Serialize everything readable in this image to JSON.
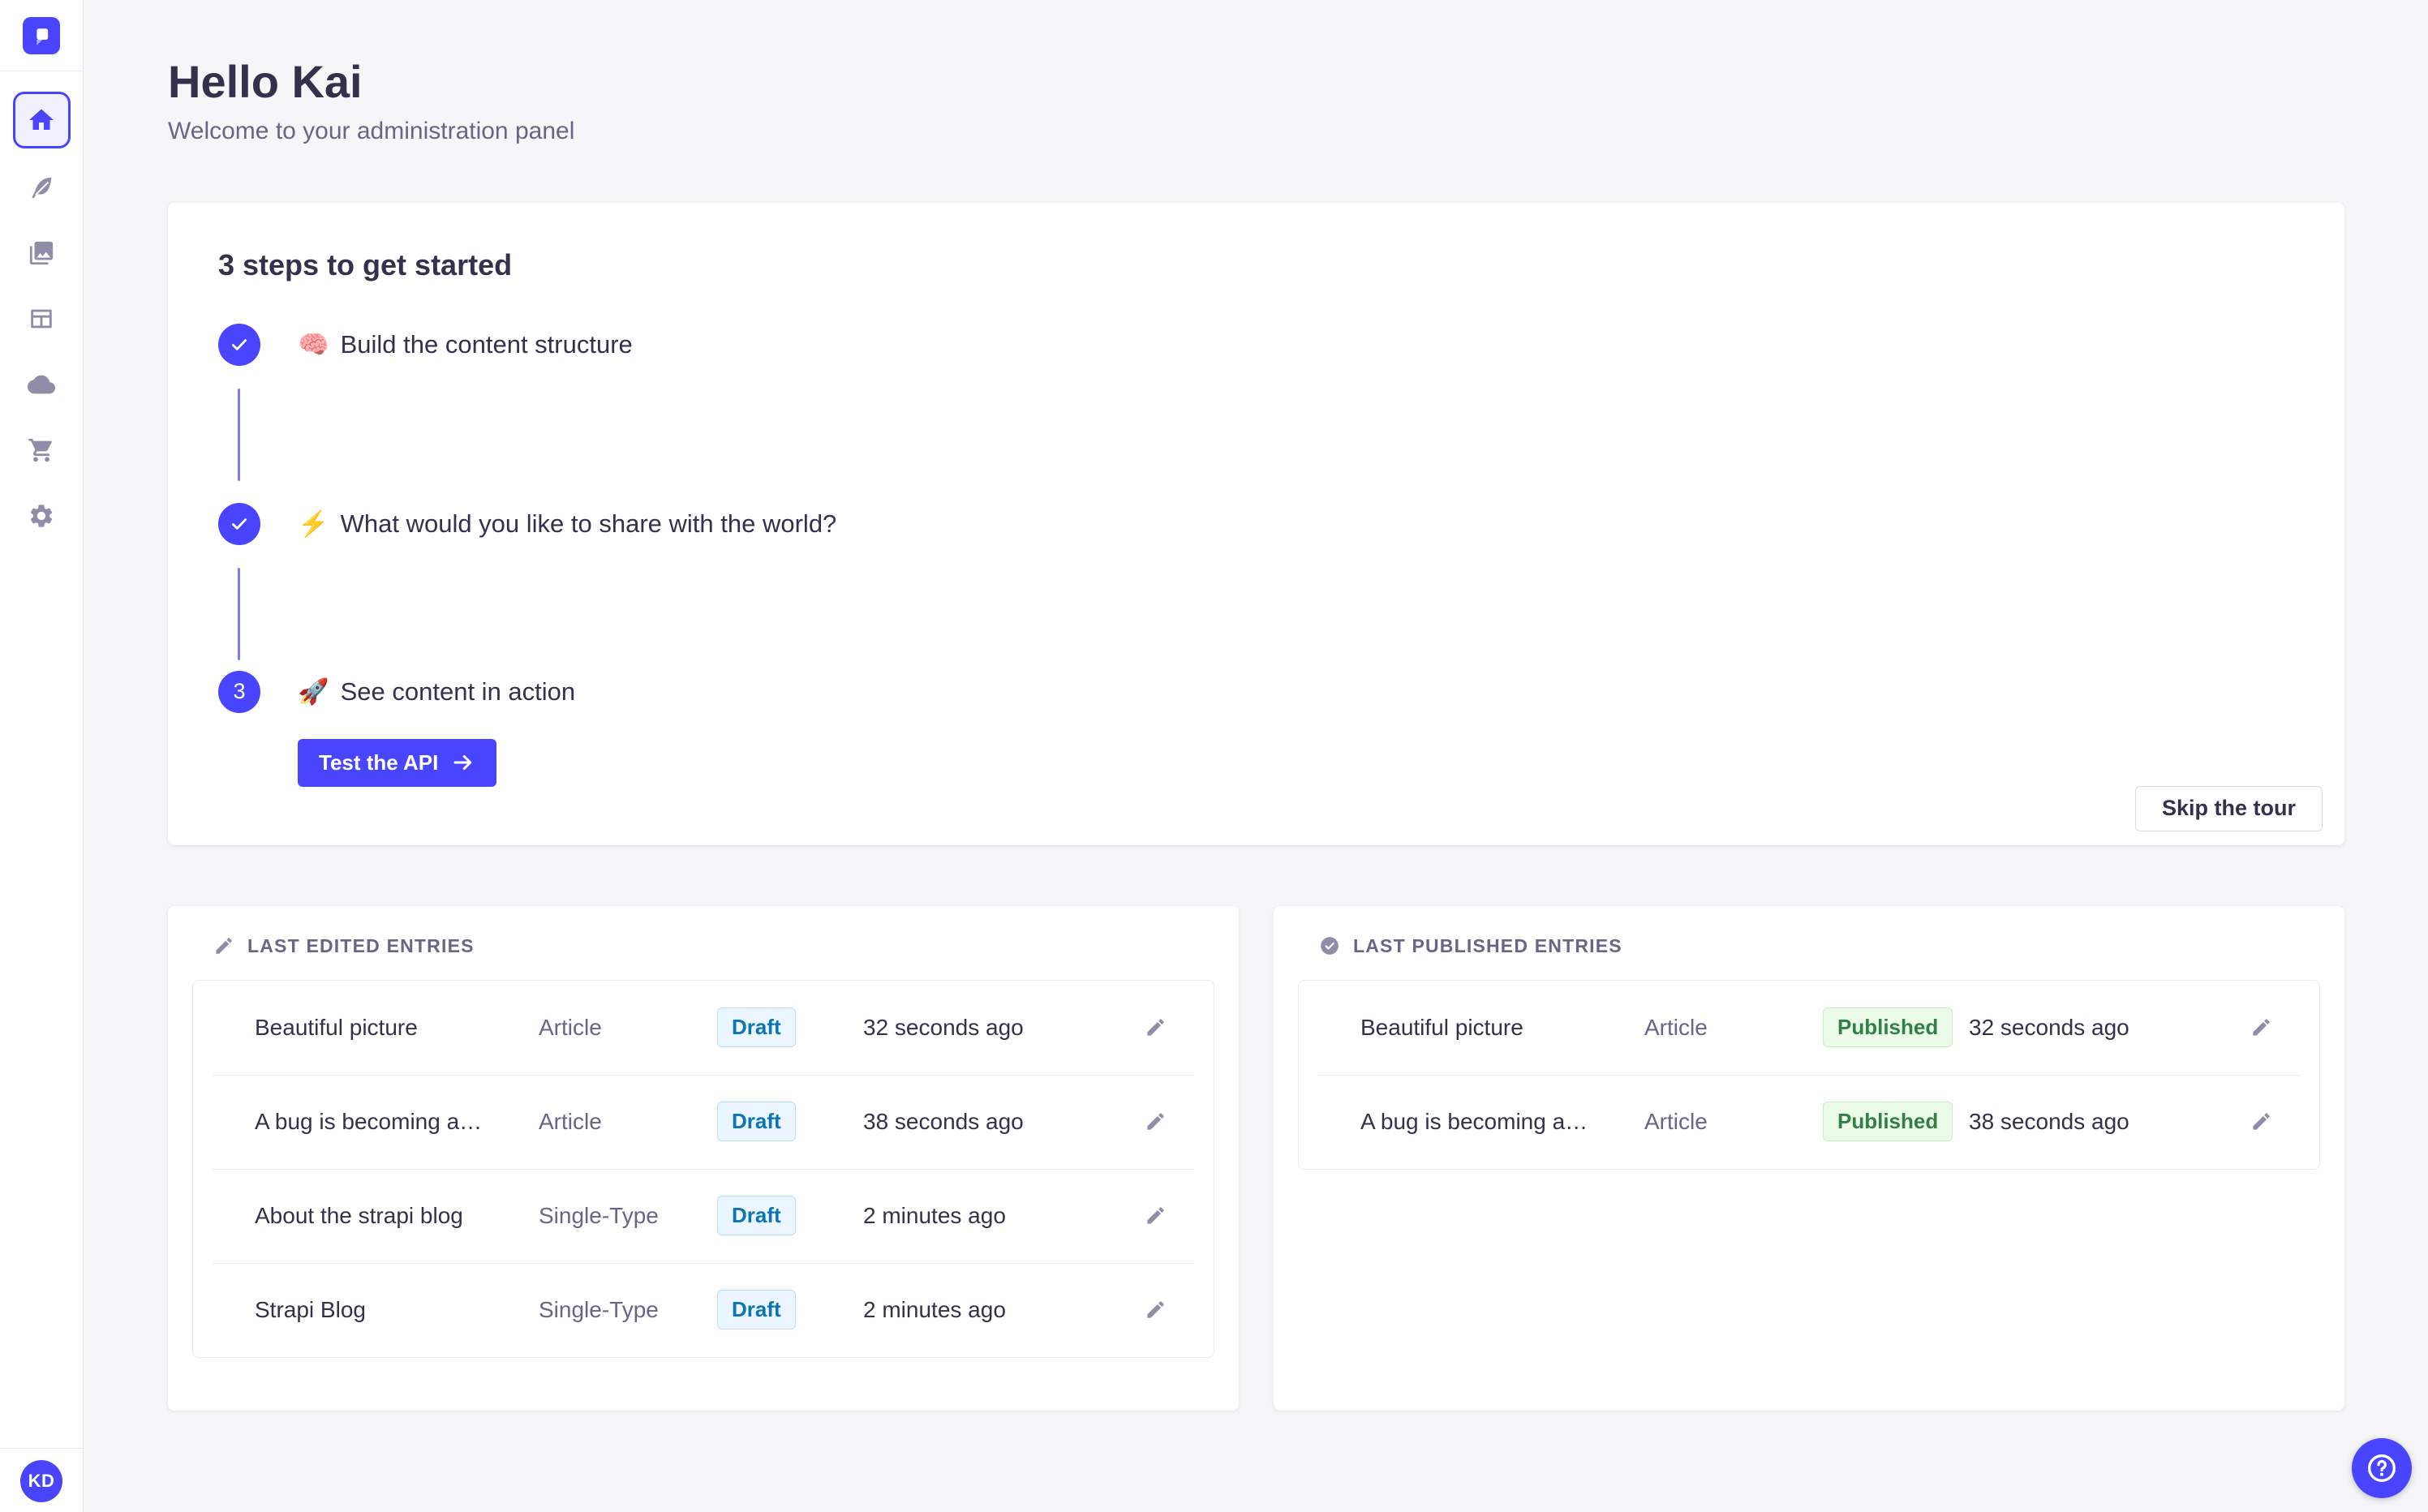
{
  "header": {
    "title": "Hello Kai",
    "subtitle": "Welcome to your administration panel"
  },
  "sidebar": {
    "items": [
      {
        "icon": "home-icon",
        "active": true
      },
      {
        "icon": "feather-icon",
        "active": false
      },
      {
        "icon": "images-icon",
        "active": false
      },
      {
        "icon": "layout-icon",
        "active": false
      },
      {
        "icon": "cloud-icon",
        "active": false
      },
      {
        "icon": "cart-icon",
        "active": false
      },
      {
        "icon": "gear-icon",
        "active": false
      }
    ],
    "avatar_initials": "KD"
  },
  "onboarding": {
    "title": "3 steps to get started",
    "steps": [
      {
        "state": "done",
        "emoji": "🧠",
        "label": "Build the content structure"
      },
      {
        "state": "done",
        "emoji": "⚡",
        "label": "What would you like to share with the world?"
      },
      {
        "state": "active",
        "number": "3",
        "emoji": "🚀",
        "label": "See content in action",
        "cta": "Test the API"
      }
    ],
    "skip_button": "Skip the tour"
  },
  "panels": {
    "edited": {
      "label": "LAST EDITED ENTRIES",
      "rows": [
        {
          "title": "Beautiful picture",
          "type": "Article",
          "status": "Draft",
          "time": "32 seconds ago"
        },
        {
          "title": "A bug is becoming a…",
          "type": "Article",
          "status": "Draft",
          "time": "38 seconds ago"
        },
        {
          "title": "About the strapi blog",
          "type": "Single-Type",
          "status": "Draft",
          "time": "2 minutes ago"
        },
        {
          "title": "Strapi Blog",
          "type": "Single-Type",
          "status": "Draft",
          "time": "2 minutes ago"
        }
      ]
    },
    "published": {
      "label": "LAST PUBLISHED ENTRIES",
      "rows": [
        {
          "title": "Beautiful picture",
          "type": "Article",
          "status": "Published",
          "time": "32 seconds ago"
        },
        {
          "title": "A bug is becoming a…",
          "type": "Article",
          "status": "Published",
          "time": "38 seconds ago"
        }
      ]
    }
  },
  "colors": {
    "primary": "#4945ff",
    "background": "#f6f6f9",
    "text_dark": "#32324d",
    "text_muted": "#666687",
    "draft_text": "#0c75af",
    "draft_bg": "#eaf5ff",
    "draft_border": "#b8e1ff",
    "published_text": "#328048",
    "published_bg": "#eafbe7",
    "published_border": "#c6f0c2"
  }
}
